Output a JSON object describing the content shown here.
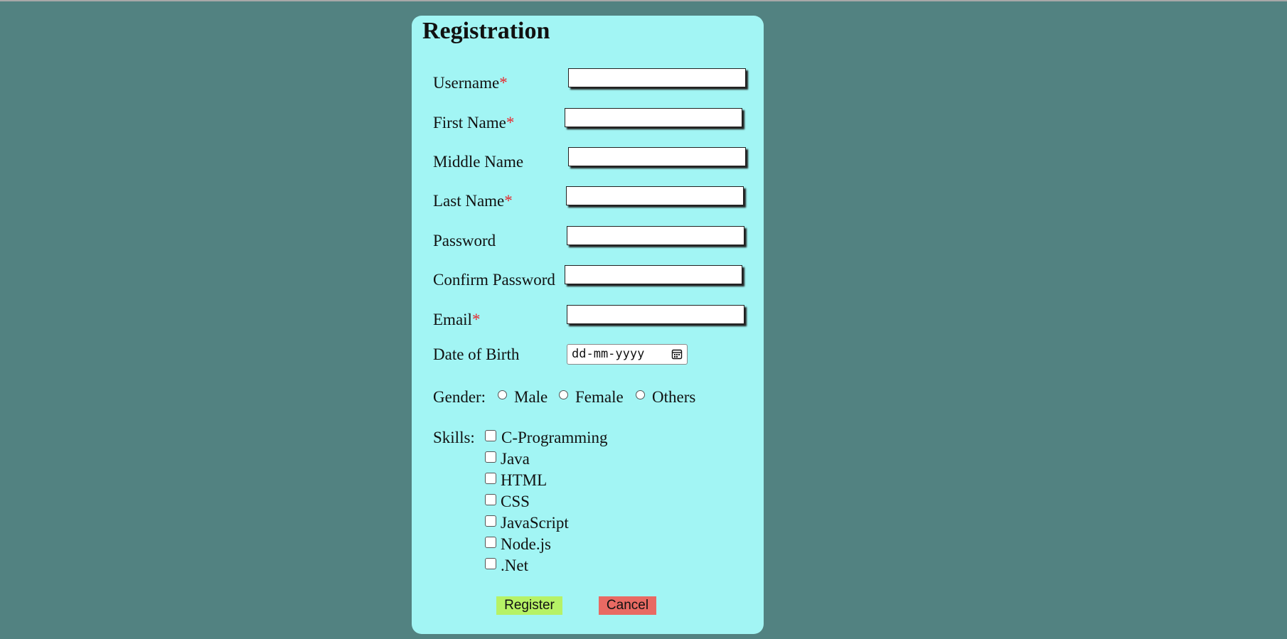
{
  "form": {
    "title": "Registration",
    "required_mark": "*",
    "fields": {
      "username": {
        "label": "Username",
        "value": ""
      },
      "first_name": {
        "label": "First Name",
        "value": ""
      },
      "middle_name": {
        "label": "Middle Name",
        "value": ""
      },
      "last_name": {
        "label": "Last Name",
        "value": ""
      },
      "password": {
        "label": "Password",
        "value": ""
      },
      "confirm_password": {
        "label": "Confirm Password",
        "value": ""
      },
      "email": {
        "label": "Email",
        "value": ""
      },
      "dob": {
        "label": "Date of Birth",
        "placeholder": "dd-mm-yyyy"
      }
    },
    "gender": {
      "label": "Gender:",
      "options": [
        "Male",
        "Female",
        "Others"
      ]
    },
    "skills": {
      "label": "Skills:",
      "options": [
        "C-Programming",
        "Java",
        "HTML",
        "CSS",
        "JavaScript",
        "Node.js",
        ".Net"
      ]
    },
    "buttons": {
      "register": "Register",
      "cancel": "Cancel"
    }
  },
  "colors": {
    "background": "#528281",
    "card": "#a2f5f4",
    "required": "#e8252a",
    "register_button": "#b6f266",
    "cancel_button": "#e86a63"
  },
  "icons": {
    "date_picker": "calendar-icon"
  }
}
